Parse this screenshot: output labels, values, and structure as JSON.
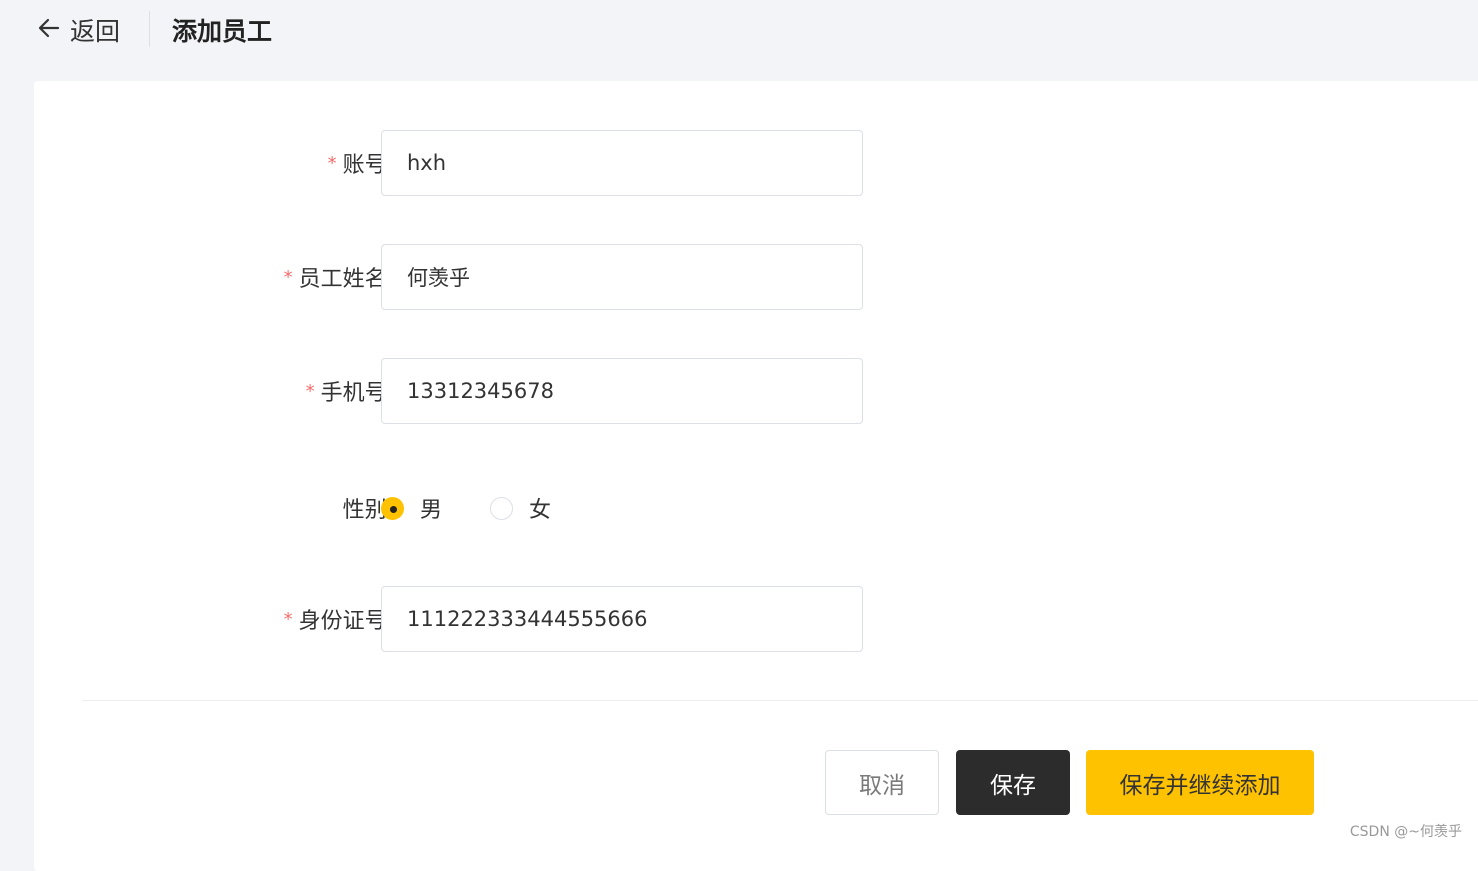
{
  "header": {
    "back_label": "返回",
    "title": "添加员工"
  },
  "form": {
    "required_mark": "*",
    "account": {
      "label": "账号:",
      "value": "hxh"
    },
    "name": {
      "label": "员工姓名:",
      "value": "何羡乎"
    },
    "phone": {
      "label": "手机号:",
      "value": "13312345678"
    },
    "gender": {
      "label": "性别:",
      "options": [
        "男",
        "女"
      ],
      "selected": "男"
    },
    "id_number": {
      "label": "身份证号:",
      "value": "111222333444555666"
    }
  },
  "actions": {
    "cancel": "取消",
    "save": "保存",
    "save_and_add": "保存并继续添加"
  },
  "watermark": "CSDN @~何羡乎",
  "colors": {
    "accent": "#ffc200",
    "dark_button": "#2c2c2c",
    "required": "#f56c6c"
  }
}
